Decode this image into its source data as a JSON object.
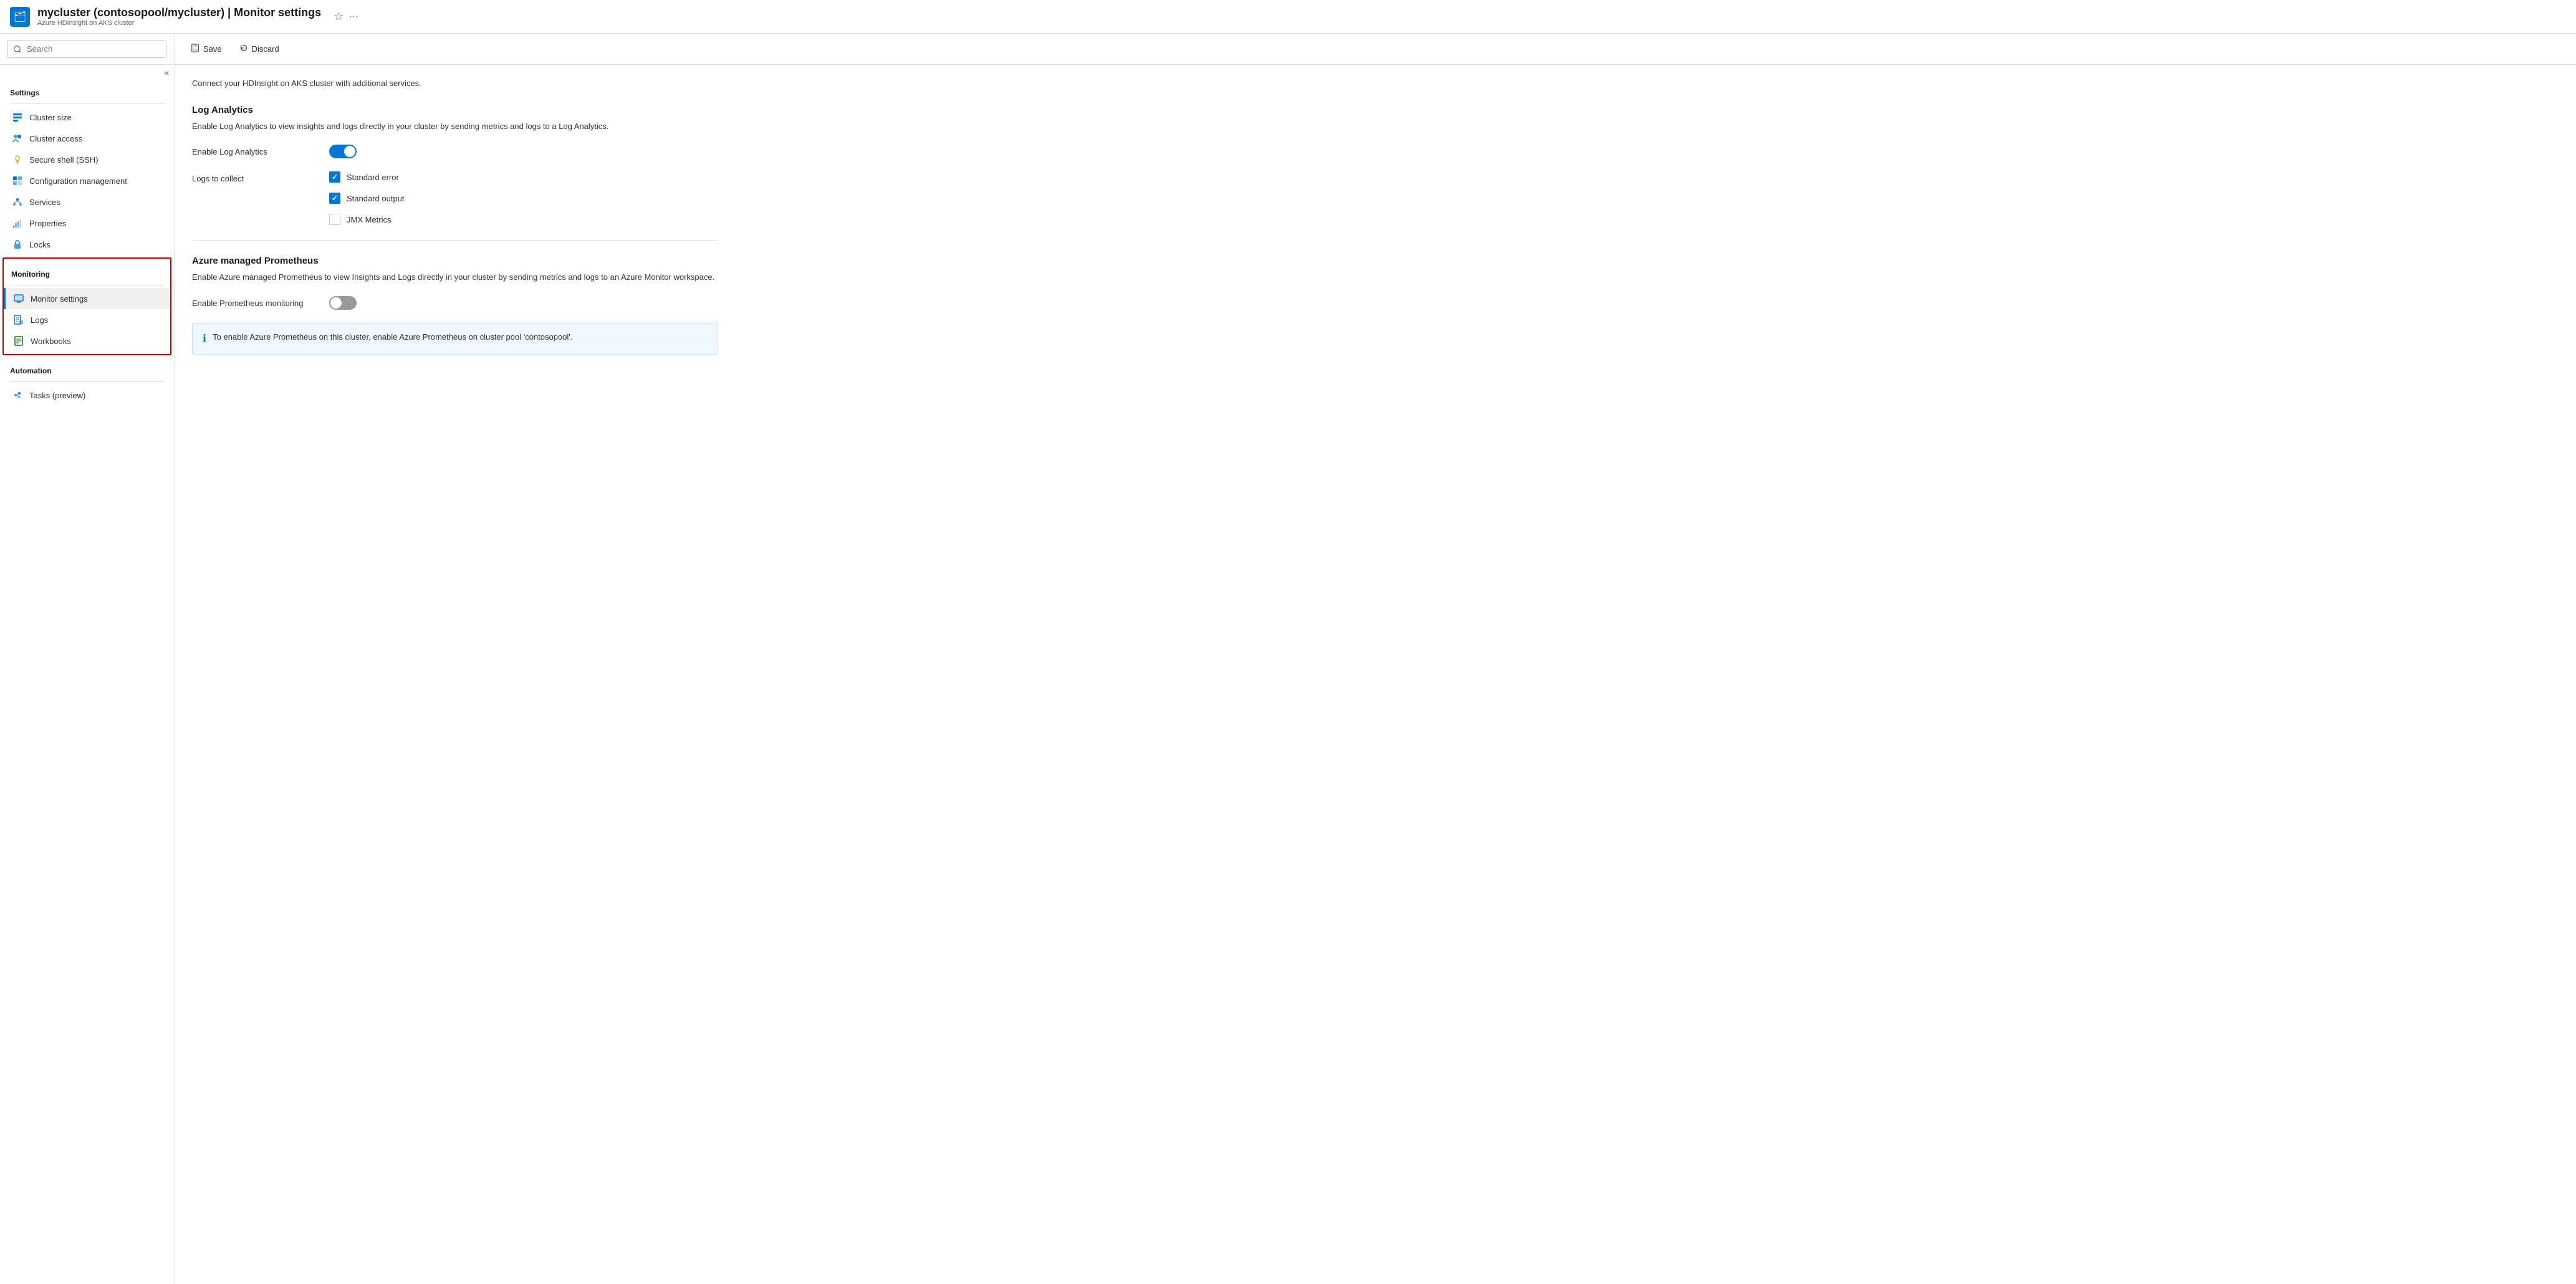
{
  "header": {
    "icon": "🗂",
    "title": "mycluster (contosopool/mycluster) | Monitor settings",
    "subtitle": "Azure HDInsight on AKS cluster",
    "star_label": "☆",
    "more_label": "···"
  },
  "sidebar": {
    "search_placeholder": "Search",
    "collapse_icon": "«",
    "settings_section": "Settings",
    "settings_items": [
      {
        "label": "Cluster size",
        "icon": "📋",
        "id": "cluster-size"
      },
      {
        "label": "Cluster access",
        "icon": "👥",
        "id": "cluster-access"
      },
      {
        "label": "Secure shell (SSH)",
        "icon": "🔑",
        "id": "ssh"
      },
      {
        "label": "Configuration management",
        "icon": "📊",
        "id": "config-mgmt"
      },
      {
        "label": "Services",
        "icon": "🏗",
        "id": "services"
      },
      {
        "label": "Properties",
        "icon": "📊",
        "id": "properties"
      },
      {
        "label": "Locks",
        "icon": "🔒",
        "id": "locks"
      }
    ],
    "monitoring_section": "Monitoring",
    "monitoring_items": [
      {
        "label": "Monitor settings",
        "icon": "📋",
        "id": "monitor-settings",
        "active": true
      },
      {
        "label": "Logs",
        "icon": "📊",
        "id": "logs"
      },
      {
        "label": "Workbooks",
        "icon": "📗",
        "id": "workbooks"
      }
    ],
    "automation_section": "Automation",
    "automation_items": [
      {
        "label": "Tasks (preview)",
        "icon": "🏗",
        "id": "tasks-preview"
      }
    ]
  },
  "toolbar": {
    "save_label": "Save",
    "discard_label": "Discard"
  },
  "main": {
    "description": "Connect your HDInsight on AKS cluster with additional services.",
    "log_analytics": {
      "title": "Log Analytics",
      "description": "Enable Log Analytics to view insights and logs directly in your cluster by sending metrics and logs to a Log Analytics.",
      "enable_label": "Enable Log Analytics",
      "enable_state": "on",
      "logs_label": "Logs to collect",
      "log_options": [
        {
          "label": "Standard error",
          "checked": true
        },
        {
          "label": "Standard output",
          "checked": true
        },
        {
          "label": "JMX Metrics",
          "checked": false
        }
      ]
    },
    "prometheus": {
      "title": "Azure managed Prometheus",
      "description": "Enable Azure managed Prometheus to view Insights and Logs directly in your cluster by sending metrics and logs to an Azure Monitor workspace.",
      "enable_label": "Enable Prometheus monitoring",
      "enable_state": "off"
    },
    "info_banner": {
      "icon": "ℹ",
      "text": "To enable Azure Prometheus on this cluster, enable Azure Prometheus on cluster pool 'contosopool'."
    }
  }
}
